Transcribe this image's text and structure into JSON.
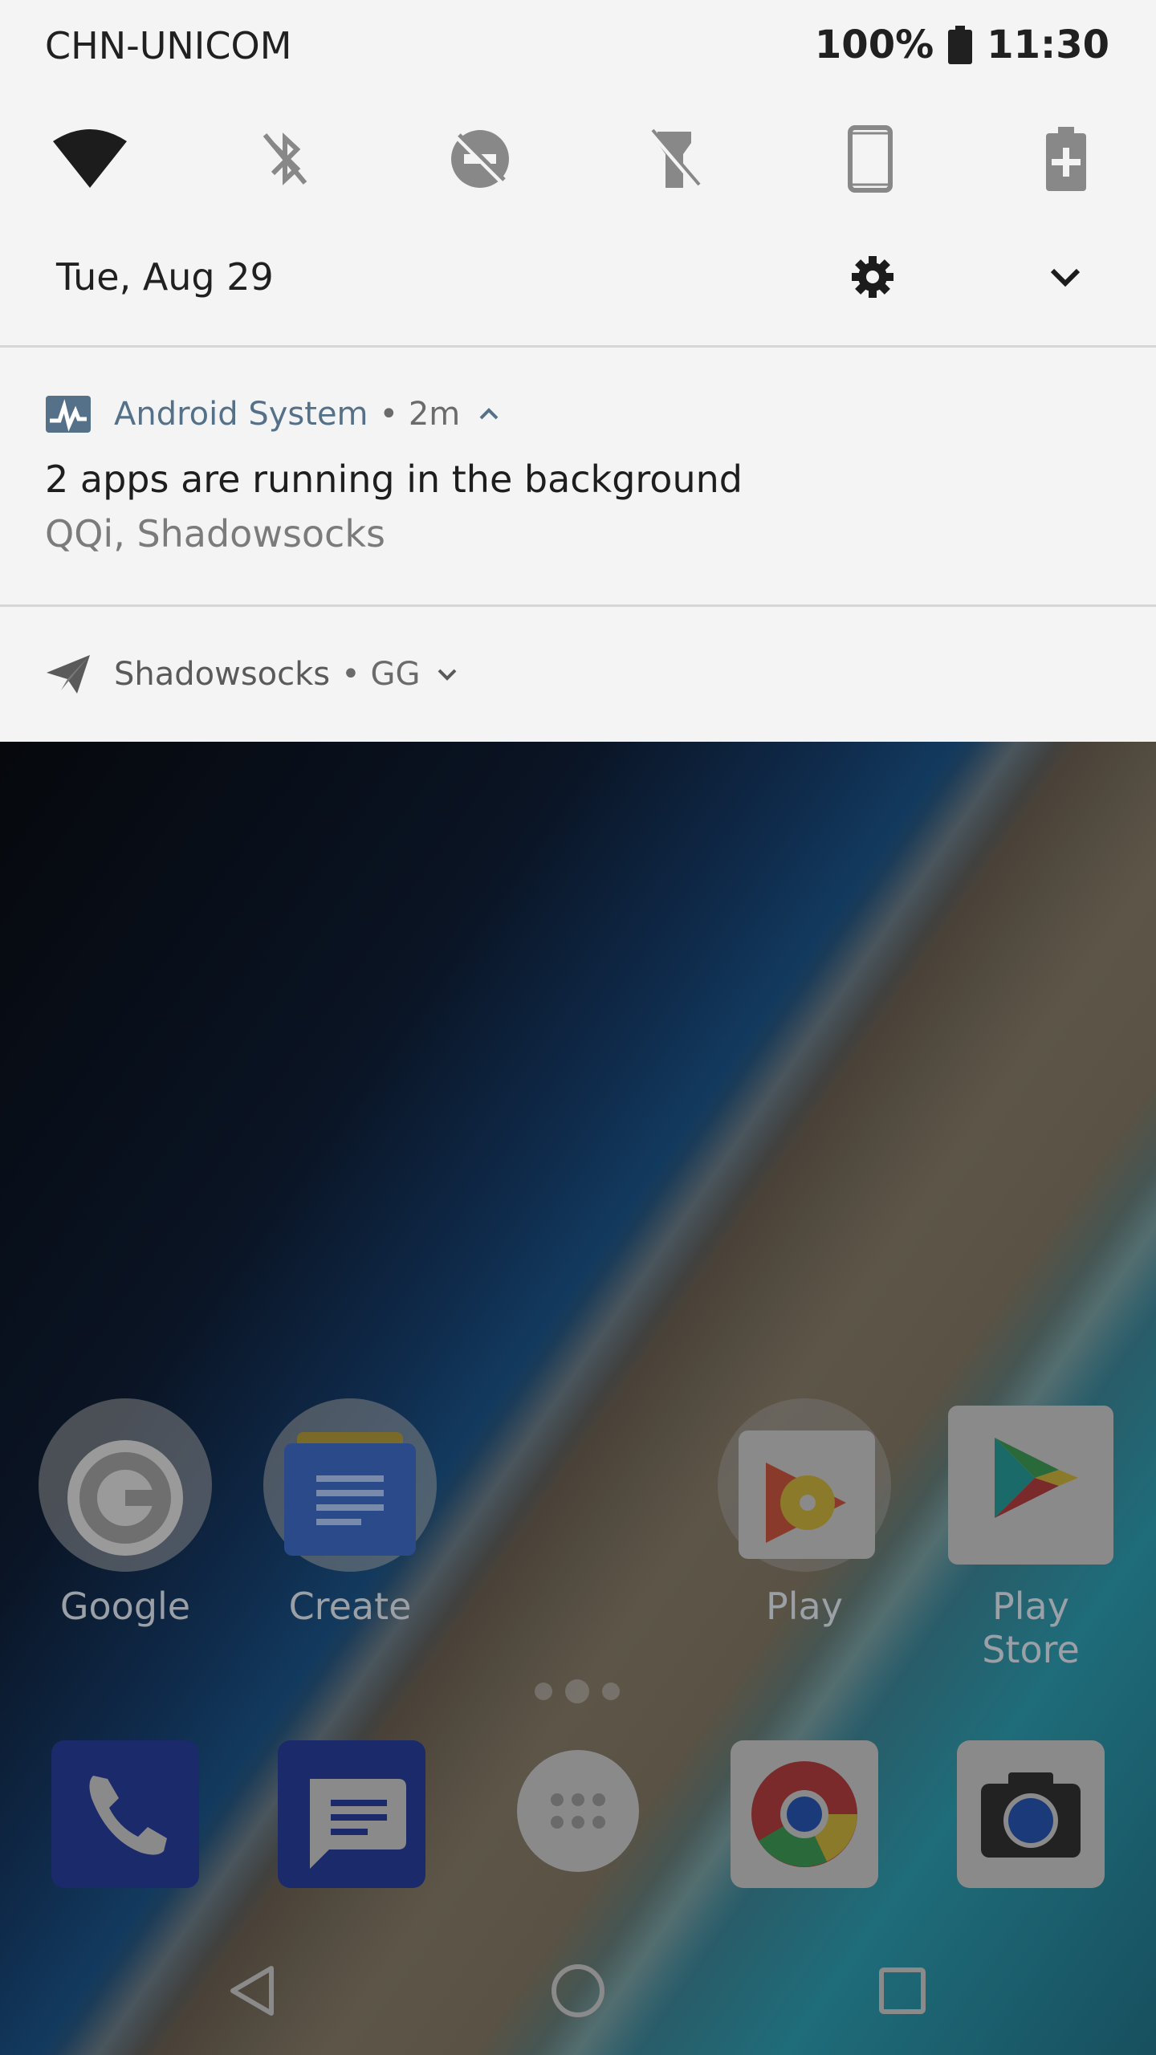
{
  "status_bar": {
    "carrier": "CHN-UNICOM",
    "battery": "100%",
    "time": "11:30"
  },
  "quick_settings": [
    {
      "name": "wifi-icon"
    },
    {
      "name": "bluetooth-off-icon"
    },
    {
      "name": "do-not-disturb-off-icon"
    },
    {
      "name": "flashlight-off-icon"
    },
    {
      "name": "auto-rotate-icon"
    },
    {
      "name": "battery-saver-icon"
    }
  ],
  "date": "Tue, Aug 29",
  "notifications": [
    {
      "app": "Android System",
      "meta": "• 2m",
      "title": "2 apps are running in the background",
      "text": "QQi, Shadowsocks"
    },
    {
      "app": "Shadowsocks",
      "meta": "• GG"
    }
  ],
  "home": {
    "apps": [
      {
        "label": "Google"
      },
      {
        "label": "Create"
      },
      {
        "label": "Play"
      },
      {
        "label": "Play Store"
      }
    ],
    "dock": [
      "phone",
      "messages",
      "all-apps",
      "chrome",
      "camera"
    ]
  },
  "colors": {
    "shade_bg": "#f4f4f4",
    "accent": "#557189",
    "text": "#202020"
  }
}
